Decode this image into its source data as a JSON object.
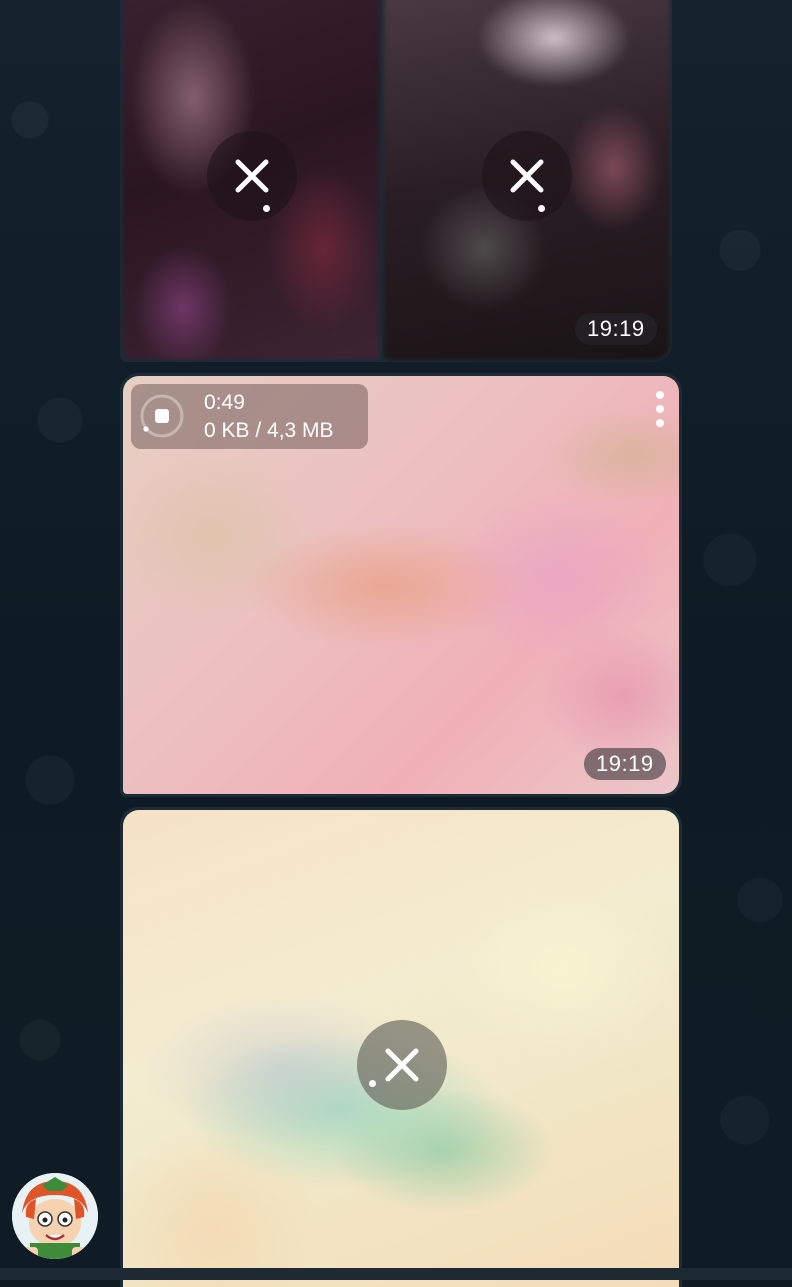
{
  "album": {
    "tiles": [
      {
        "state": "downloading",
        "icon": "close-icon"
      },
      {
        "state": "downloading",
        "icon": "close-icon"
      }
    ],
    "time": "19:19"
  },
  "video": {
    "duration": "0:49",
    "size_progress": "0 KB / 4,3 MB",
    "time": "19:19",
    "menu_icon": "more-vertical-icon"
  },
  "photo": {
    "state": "downloading",
    "icon": "close-icon"
  },
  "sender": {
    "avatar_icon": "cartoon-avatar"
  },
  "colors": {
    "background": "#0f1a22",
    "bubble": "#1c2b36",
    "overlay": "rgba(30,20,25,0.62)",
    "text": "#ffffff"
  }
}
